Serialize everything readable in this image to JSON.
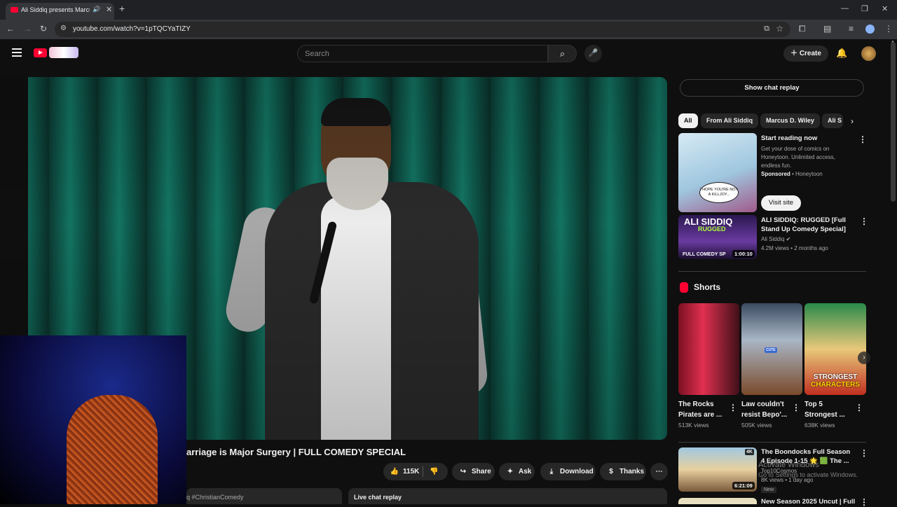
{
  "browser": {
    "tab_title": "Ali Siddiq presents Marcus",
    "tab_audio_icon": "speaker-icon",
    "new_tab": "+",
    "url": "youtube.com/watch?v=1pTQCYaTIZY",
    "window_controls": [
      "—",
      "❐",
      "✕"
    ]
  },
  "header": {
    "search_placeholder": "Search",
    "create_label": "Create"
  },
  "video": {
    "title": "arriage is Major Surgery | FULL COMEDY SPECIAL",
    "likes": "115K",
    "share_label": "Share",
    "ask_label": "Ask",
    "download_label": "Download",
    "thanks_label": "Thanks",
    "description_snippet": "q #ChristianComedy",
    "live_chat_label": "Live chat replay"
  },
  "sidebar": {
    "show_chat_label": "Show chat replay",
    "chips": [
      "All",
      "From Ali Siddiq",
      "Marcus D. Wiley",
      "Ali S"
    ],
    "ad": {
      "title": "Start reading now",
      "description": "Get your dose of comics on Honeytoon. Unlimited access, endless fun.",
      "sponsored": "Sponsored",
      "advertiser": "Honeytoon",
      "cta": "Visit site",
      "thumb_bubble": "I HOPE YOU'RE NOT A KILLJOY..."
    },
    "rec1": {
      "thumb_title": "ALI SIDDIQ",
      "thumb_sub": "RUGGED",
      "thumb_footer": "FULL COMEDY SP",
      "duration": "1:00:10",
      "title": "ALI SIDDIQ: RUGGED [Full Stand Up Comedy Special]",
      "channel": "Ali Siddiq",
      "meta": "4.2M views • 2 months ago"
    },
    "shorts": {
      "label": "Shorts",
      "items": [
        {
          "title": "The Rocks Pirates are ...",
          "views": "513K views"
        },
        {
          "title": "Law couldn't resist Bepo'...",
          "views": "505K views"
        },
        {
          "title": "Top 5 Strongest ...",
          "views": "638K views",
          "cap1": "STRONGEST",
          "cap2": "CHARACTERS"
        }
      ],
      "short2_badge": "CUTE"
    },
    "rec2": {
      "title": "The Boondocks Full Season 4 Episode 1-15 🌟 🟩 The ...",
      "channel": "Top10Cosmos",
      "meta": "8K views • 1 day ago",
      "badge": "New",
      "badge_4k": "4K",
      "duration": "6:21:09"
    },
    "rec3_title": "New Season 2025 Uncut | Full"
  },
  "watermark": {
    "line1": "Activate Windows",
    "line2": "Go to Settings to activate Windows."
  }
}
